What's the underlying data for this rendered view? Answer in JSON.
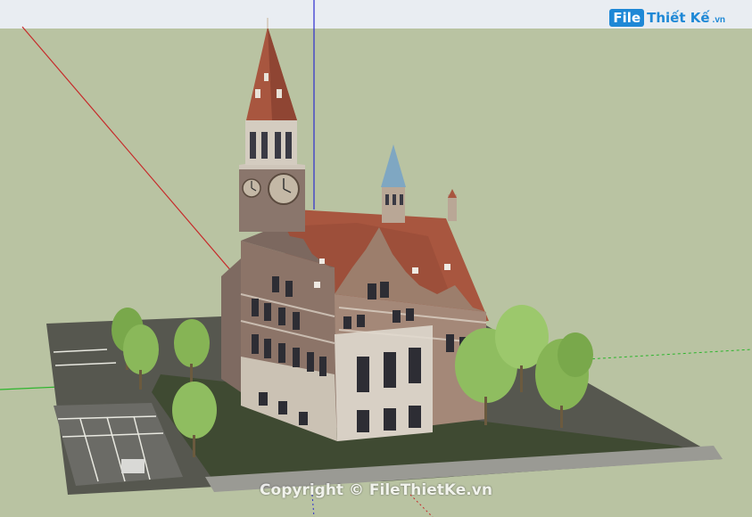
{
  "app": {
    "view": "3D model viewport"
  },
  "colors": {
    "sky": "#e9edf2",
    "ground": "#b9c3a2",
    "axis_red": "#c62a2a",
    "axis_green": "#2bb52b",
    "axis_blue": "#2c2ccf",
    "roof": "#a8563f",
    "brick": "#8c7468",
    "stone": "#d8d0c5",
    "tree": "#79a84b",
    "street": "#5a5a58"
  },
  "watermark": {
    "logo_box": "File",
    "logo_text": "Thiết Kế",
    "logo_suffix": ".vn",
    "copyright": "Copyright © FileThietKe.vn"
  },
  "scene": {
    "building": "brick-building-model",
    "icons": [
      "clock-icon",
      "tree-icon"
    ]
  }
}
